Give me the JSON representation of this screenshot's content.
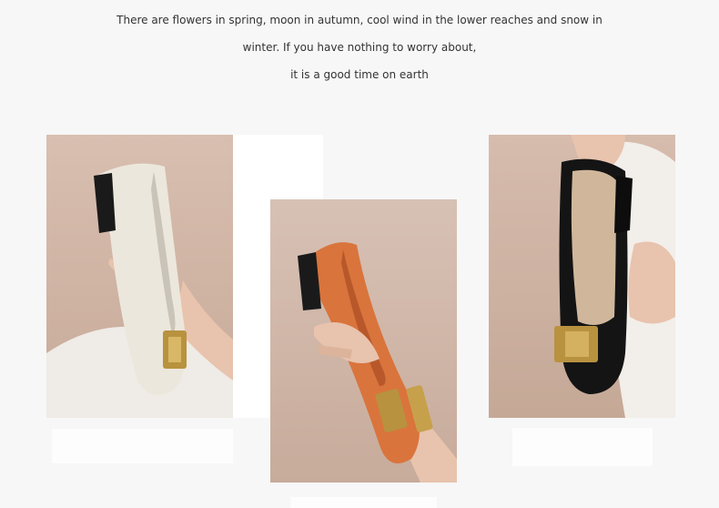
{
  "intro": {
    "line1": "There are flowers in spring, moon in autumn, cool wind in the lower reaches and snow in",
    "line2": "winter. If you have nothing to worry about,",
    "line3": "it is a good time on earth"
  },
  "products": [
    {
      "name": "white-loafer",
      "shoe_color": "#ece7dc",
      "buckle_color": "#b8923f"
    },
    {
      "name": "orange-loafer",
      "shoe_color": "#d9743c",
      "buckle_color": "#b8923f"
    },
    {
      "name": "black-loafer",
      "shoe_color": "#141414",
      "buckle_color": "#b8923f"
    }
  ],
  "colors": {
    "page_background": "#f7f7f7",
    "text": "#333333",
    "photo_background": "#d2b7a7"
  }
}
